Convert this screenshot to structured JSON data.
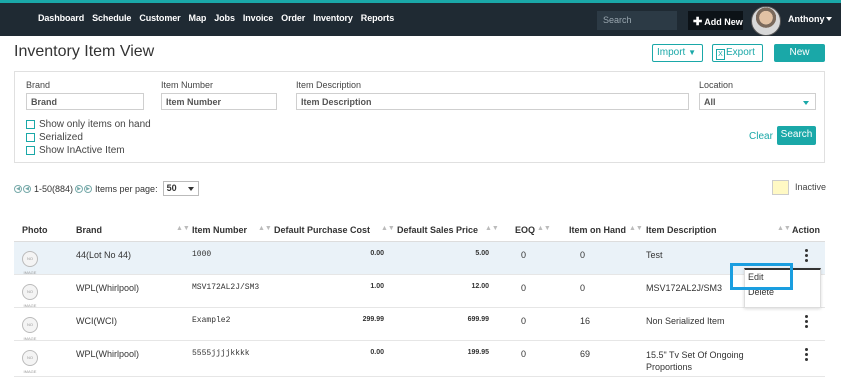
{
  "nav": {
    "items": [
      "Dashboard",
      "Schedule",
      "Customer",
      "Map",
      "Jobs",
      "Invoice",
      "Order",
      "Inventory",
      "Reports"
    ],
    "active": "Inventory",
    "search_placeholder": "Search",
    "add_new_label": "Add New",
    "user_name": "Anthony"
  },
  "page": {
    "title": "Inventory Item View",
    "import_label": "Import",
    "export_label": "Export",
    "new_label": "New"
  },
  "filters": {
    "brand_label": "Brand",
    "brand_placeholder": "Brand",
    "item_number_label": "Item Number",
    "item_number_placeholder": "Item Number",
    "item_desc_label": "Item Description",
    "item_desc_placeholder": "Item Description",
    "location_label": "Location",
    "location_value": "All",
    "check_on_hand": "Show only items on hand",
    "check_serialized": "Serialized",
    "check_inactive": "Show InActive Item",
    "clear_label": "Clear",
    "search_label": "Search"
  },
  "pager": {
    "range": "1-50(884)",
    "per_page_label": "Items per page:",
    "per_page_value": "50",
    "inactive_label": "Inactive"
  },
  "table": {
    "headers": [
      "Photo",
      "Brand",
      "Item Number",
      "Default Purchase Cost",
      "Default Sales Price",
      "EOQ",
      "Item on Hand",
      "Item Description",
      "Action"
    ],
    "rows": [
      {
        "brand": "44(Lot No 44)",
        "item_number": "1000",
        "purchase_cost": "0.00",
        "sales_price": "5.00",
        "eoq": "0",
        "on_hand": "0",
        "description": "Test"
      },
      {
        "brand": "WPL(Whirlpool)",
        "item_number": "MSV172AL2J/SM3",
        "purchase_cost": "1.00",
        "sales_price": "12.00",
        "eoq": "0",
        "on_hand": "0",
        "description": "MSV172AL2J/SM3"
      },
      {
        "brand": "WCI(WCI)",
        "item_number": "Example2",
        "purchase_cost": "299.99",
        "sales_price": "699.99",
        "eoq": "0",
        "on_hand": "16",
        "description": "Non Serialized Item"
      },
      {
        "brand": "WPL(Whirlpool)",
        "item_number": "5555jjjjkkkk",
        "purchase_cost": "0.00",
        "sales_price": "199.95",
        "eoq": "0",
        "on_hand": "69",
        "description": "15.5\" Tv Set Of Ongoing Proportions"
      }
    ]
  },
  "action_menu": {
    "edit_label": "Edit",
    "delete_label": "Delete"
  },
  "colors": {
    "accent": "#1aa8a8",
    "navbar": "#1f2a33",
    "highlight": "#1a9ee0"
  }
}
